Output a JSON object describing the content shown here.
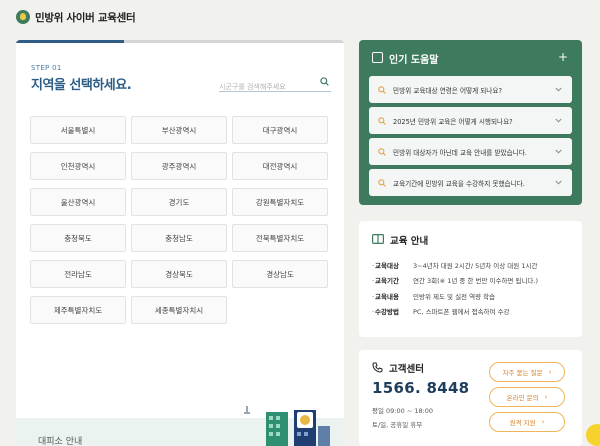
{
  "header": {
    "site_title": "민방위 사이버 교육센터"
  },
  "region_panel": {
    "step": "STEP 01",
    "title": "지역을 선택하세요.",
    "progress_fraction": 0.33,
    "search_placeholder": "시군구를 검색해주세요",
    "regions": [
      "서울특별시",
      "부산광역시",
      "대구광역시",
      "인천광역시",
      "광주광역시",
      "대전광역시",
      "울산광역시",
      "경기도",
      "강원특별자치도",
      "충청북도",
      "충청남도",
      "전북특별자치도",
      "전라남도",
      "경상북도",
      "경상남도",
      "제주특별자치도",
      "세종특별자치시"
    ],
    "evacuation_label": "대피소 안내"
  },
  "popular_help": {
    "title": "인기 도움말",
    "items": [
      "민방위 교육대상 연령은 어떻게 되나요?",
      "2025년 민방위 교육은 어떻게 시행되나요?",
      "민방위 대상자가 아닌데 교육 안내를 받았습니다.",
      "교육기간에 민방위 교육을 수강하지 못했습니다."
    ]
  },
  "education_info": {
    "title": "교육 안내",
    "rows": [
      {
        "key": "교육대상",
        "value": "3~4년차 대원 2시간/ 5년차 이상 대원 1시간"
      },
      {
        "key": "교육기간",
        "value": "연간 3회(※ 1년 중 한 번만 이수하면 됩니다.)"
      },
      {
        "key": "교육내용",
        "value": "민방위 제도 및 실전 역량 학습"
      },
      {
        "key": "수강방법",
        "value": "PC, 스마트폰 웹에서 접속하여 수강"
      }
    ]
  },
  "customer_center": {
    "title": "고객센터",
    "phone": "1566. 8448",
    "hours": "평일 09:00 ~ 18:00",
    "closed": "토/일, 공휴일 휴무",
    "buttons": [
      "자주 묻는 질문",
      "온라인 문의",
      "원격 지원"
    ]
  },
  "colors": {
    "primary_blue": "#2c5d87",
    "help_green": "#3d7a5e",
    "accent_orange": "#f0b45a",
    "background": "#f1f1ee"
  }
}
